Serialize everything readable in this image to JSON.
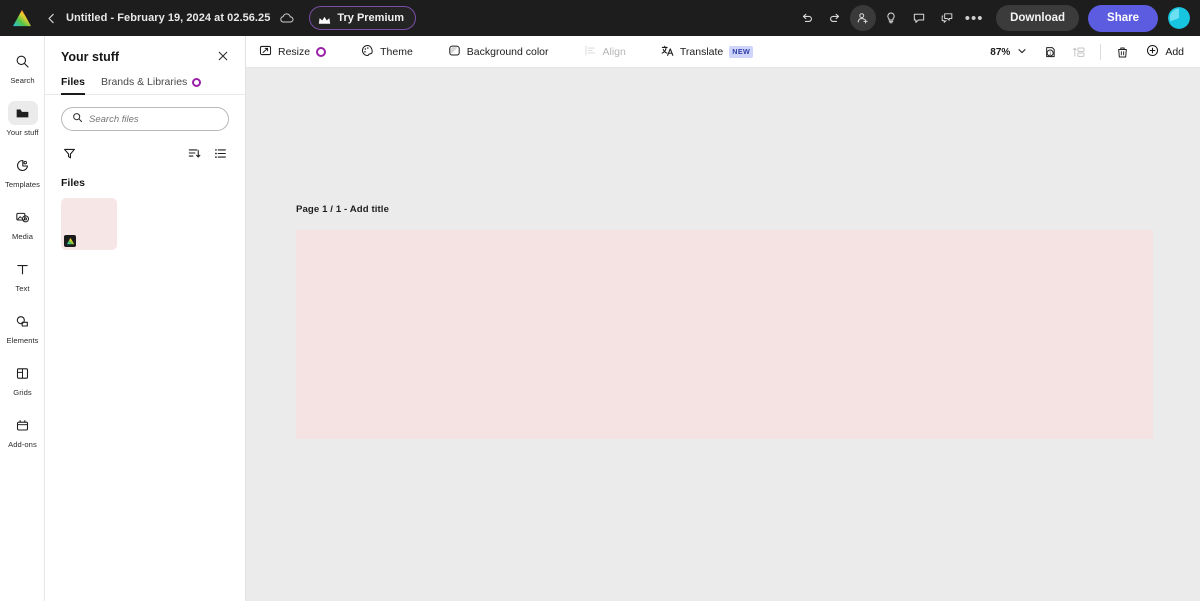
{
  "topbar": {
    "logo_icon": "adobe-logo",
    "back_icon": "chevron-left-icon",
    "doc_title": "Untitled - February 19, 2024 at 02.56.25",
    "cloud_icon": "cloud-saved-icon",
    "try_premium_label": "Try Premium",
    "crown_icon": "crown-icon",
    "undo_icon": "undo-icon",
    "redo_icon": "redo-icon",
    "invite_icon": "add-person-icon",
    "ideas_icon": "lightbulb-icon",
    "comment_icon": "comment-icon",
    "feedback_icon": "feedback-icon",
    "more_label": "•••",
    "download_label": "Download",
    "share_label": "Share",
    "avatar_icon": "user-avatar",
    "share_color": "#5c5ce0",
    "avatar_color": "#18c8e0",
    "bg_color": "#1d1d1d"
  },
  "rail": {
    "items": [
      {
        "label": "Search",
        "icon": "search-icon",
        "active": false
      },
      {
        "label": "Your stuff",
        "icon": "folder-icon",
        "active": true
      },
      {
        "label": "Templates",
        "icon": "templates-icon",
        "active": false
      },
      {
        "label": "Media",
        "icon": "media-icon",
        "active": false
      },
      {
        "label": "Text",
        "icon": "text-icon",
        "active": false
      },
      {
        "label": "Elements",
        "icon": "elements-icon",
        "active": false
      },
      {
        "label": "Grids",
        "icon": "grids-icon",
        "active": false
      },
      {
        "label": "Add-ons",
        "icon": "addons-icon",
        "active": false
      }
    ]
  },
  "panel": {
    "title": "Your stuff",
    "close_icon": "close-icon",
    "tabs": [
      {
        "label": "Files",
        "active": true,
        "badge": false
      },
      {
        "label": "Brands & Libraries",
        "active": false,
        "badge": true
      }
    ],
    "search": {
      "placeholder": "Search files",
      "value": "",
      "icon": "search-icon"
    },
    "filter_icon": "filter-funnel-icon",
    "sort_icon": "sort-icon",
    "view_icon": "list-view-icon",
    "files_section_label": "Files",
    "files": [
      {
        "name": "file-thumbnail",
        "thumb_color": "#f7e6e6",
        "badge_icon": "adobe-logo"
      }
    ],
    "badge_color": "#9b1fa8"
  },
  "toolbar": {
    "items": [
      {
        "label": "Resize",
        "icon": "resize-icon",
        "badge": "dot",
        "disabled": false
      },
      {
        "label": "Theme",
        "icon": "theme-palette-icon",
        "badge": "none",
        "disabled": false
      },
      {
        "label": "Background color",
        "icon": "background-color-icon",
        "badge": "none",
        "disabled": false
      },
      {
        "label": "Align",
        "icon": "align-icon",
        "badge": "none",
        "disabled": true
      },
      {
        "label": "Translate",
        "icon": "translate-icon",
        "badge": "new",
        "disabled": false
      }
    ],
    "new_badge_label": "NEW",
    "zoom_level": "87%",
    "zoom_chevron_icon": "chevron-down-icon",
    "pages_icon": "pages-count-icon",
    "pages_count": "1",
    "arrange_icon": "arrange-icon",
    "delete_icon": "trash-icon",
    "add_label": "Add",
    "add_icon": "plus-circle-icon"
  },
  "canvas": {
    "page_label": "Page 1 / 1 - Add title",
    "artboard_color": "#f5e3e3",
    "workspace_color": "#ebebeb"
  }
}
